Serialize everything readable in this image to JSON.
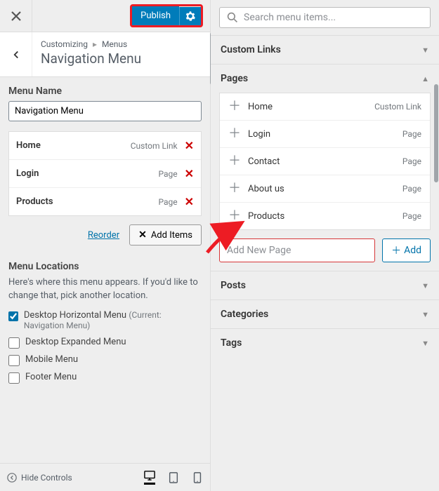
{
  "header": {
    "publish_label": "Publish"
  },
  "breadcrumb": {
    "root": "Customizing",
    "parent": "Menus",
    "title": "Navigation Menu"
  },
  "menu_name": {
    "label": "Menu Name",
    "value": "Navigation Menu"
  },
  "menu_items": [
    {
      "label": "Home",
      "type": "Custom Link"
    },
    {
      "label": "Login",
      "type": "Page"
    },
    {
      "label": "Products",
      "type": "Page"
    }
  ],
  "reorder_label": "Reorder",
  "add_items_label": "Add Items",
  "locations": {
    "heading": "Menu Locations",
    "description": "Here's where this menu appears. If you'd like to change that, pick another location.",
    "options": [
      {
        "label": "Desktop Horizontal Menu",
        "suffix": "(Current: Navigation Menu)",
        "checked": true
      },
      {
        "label": "Desktop Expanded Menu",
        "suffix": "",
        "checked": false
      },
      {
        "label": "Mobile Menu",
        "suffix": "",
        "checked": false
      },
      {
        "label": "Footer Menu",
        "suffix": "",
        "checked": false
      }
    ]
  },
  "footer": {
    "hide_controls": "Hide Controls"
  },
  "search": {
    "placeholder": "Search menu items..."
  },
  "sections": {
    "custom_links": "Custom Links",
    "pages": "Pages",
    "posts": "Posts",
    "categories": "Categories",
    "tags": "Tags"
  },
  "pages_list": [
    {
      "label": "Home",
      "type": "Custom Link"
    },
    {
      "label": "Login",
      "type": "Page"
    },
    {
      "label": "Contact",
      "type": "Page"
    },
    {
      "label": "About us",
      "type": "Page"
    },
    {
      "label": "Products",
      "type": "Page"
    }
  ],
  "add_new": {
    "placeholder": "Add New Page",
    "button": "Add"
  }
}
